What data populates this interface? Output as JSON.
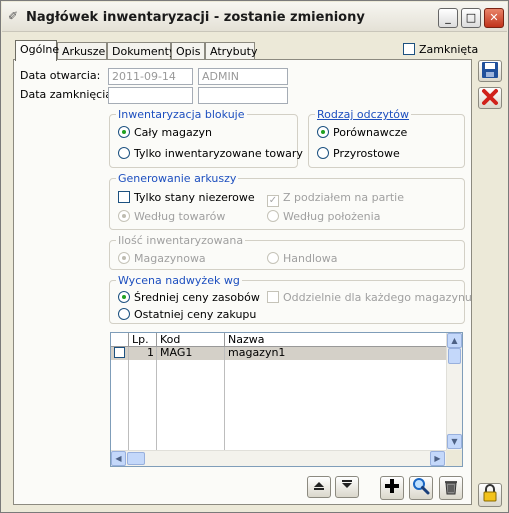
{
  "window": {
    "title": "Nagłówek inwentaryzacji - zostanie zmieniony",
    "minimize_glyph": "_",
    "maximize_glyph": "□",
    "close_glyph": "✕"
  },
  "tabs": [
    {
      "label": "Ogólne",
      "active": true
    },
    {
      "label": "Arkusze",
      "active": false
    },
    {
      "label": "Dokumenty",
      "active": false
    },
    {
      "label": "Opis",
      "active": false
    },
    {
      "label": "Atrybuty",
      "active": false
    }
  ],
  "closed_checkbox": {
    "label": "Zamknięta",
    "checked": false
  },
  "dates": {
    "opened_label": "Data otwarcia:",
    "opened_value": "2011-09-14",
    "opened_user": "ADMIN",
    "closed_label": "Data zamknięcia:",
    "closed_value": "",
    "closed_user": ""
  },
  "blocking": {
    "title": "Inwentaryzacja blokuje",
    "options": [
      "Cały magazyn",
      "Tylko inwentaryzowane towary"
    ],
    "selected": 0
  },
  "reading_type": {
    "title": "Rodzaj odczytów",
    "options": [
      "Porównawcze",
      "Przyrostowe"
    ],
    "selected": 0
  },
  "sheet_generation": {
    "title": "Generowanie arkuszy",
    "nonzero_label": "Tylko stany niezerowe",
    "partition_label": "Z podziałem na partie",
    "by_goods_label": "Według towarów",
    "by_location_label": "Według położenia"
  },
  "quantity": {
    "title": "Ilość inwentaryzowana",
    "options": [
      "Magazynowa",
      "Handlowa"
    ],
    "selected": 0
  },
  "valuation": {
    "title": "Wycena nadwyżek wg",
    "options": [
      "Średniej ceny zasobów",
      "Ostatniej ceny zakupu"
    ],
    "selected": 0,
    "separate_label": "Oddzielnie dla każdego magazynu"
  },
  "warehouse_table": {
    "columns": [
      "Lp.",
      "Kod",
      "Nazwa"
    ],
    "rows": [
      {
        "checked": false,
        "lp": "1",
        "kod": "MAG1",
        "nazwa": "magazyn1"
      }
    ]
  },
  "toolbar": {
    "save_icon": "floppy-disk-icon",
    "cancel_icon": "red-x-icon",
    "up_icon": "arrow-up-icon",
    "down_icon": "arrow-down-icon",
    "add_icon": "plus-icon",
    "search_icon": "magnifier-icon",
    "delete_icon": "trash-icon",
    "lock_icon": "padlock-icon"
  }
}
